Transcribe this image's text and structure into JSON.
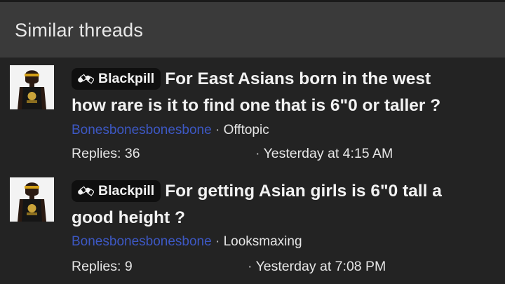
{
  "header": {
    "title": "Similar threads"
  },
  "threads": [
    {
      "prefix": "Blackpill",
      "prefix_icon": "pills-icon",
      "title_line1": "For East Asians born in the west",
      "title_line2": "how rare is it to find one that is 6\"0 or taller ?",
      "author": "Bonesbonesbonesbone",
      "separator": "·",
      "forum": "Offtopic",
      "replies": "Replies: 36",
      "date_separator": "·",
      "date": "Yesterday at 4:15 AM"
    },
    {
      "prefix": "Blackpill",
      "prefix_icon": "pills-icon",
      "title_line1": "For getting Asian girls is 6\"0 tall a",
      "title_line2": "good height ?",
      "author": "Bonesbonesbonesbone",
      "separator": "·",
      "forum": "Looksmaxing",
      "replies": "Replies: 9",
      "date_separator": "·",
      "date": "Yesterday at 7:08 PM"
    }
  ],
  "colors": {
    "background": "#232323",
    "header_background": "#3a3a3a",
    "author_link": "#3d58c4",
    "prefix_background": "#0f0f0f"
  }
}
